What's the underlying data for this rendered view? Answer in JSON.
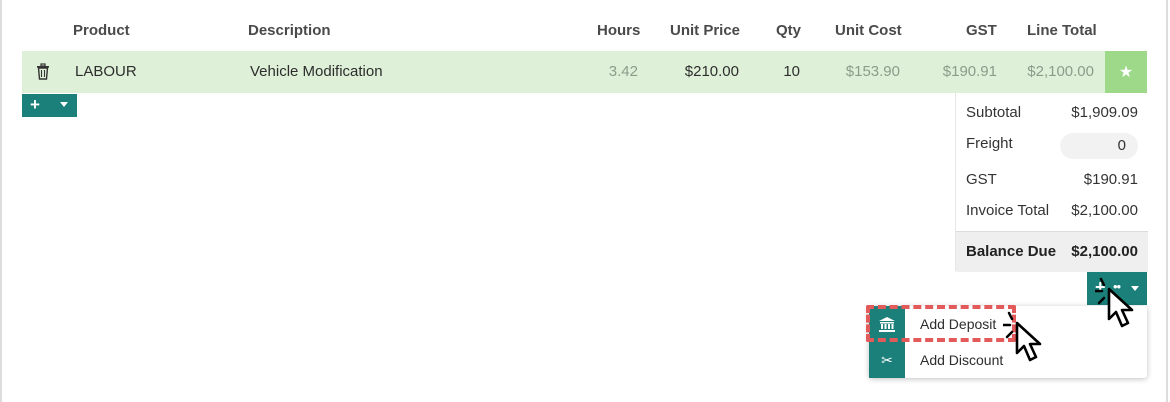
{
  "table": {
    "headers": {
      "product": "Product",
      "description": "Description",
      "hours": "Hours",
      "unit_price": "Unit Price",
      "qty": "Qty",
      "unit_cost": "Unit Cost",
      "gst": "GST",
      "line_total": "Line Total"
    },
    "rows": [
      {
        "product": "LABOUR",
        "description": "Vehicle Modification",
        "hours": "3.42",
        "unit_price": "$210.00",
        "qty": "10",
        "unit_cost": "$153.90",
        "gst": "$190.91",
        "line_total": "$2,100.00"
      }
    ],
    "row_bg": "#dff0d8",
    "row_icon": "trash-icon",
    "row_action_icon": "star-icon"
  },
  "add_line": {
    "icon": "plus-icon",
    "caret_icon": "chevron-down-icon"
  },
  "totals": {
    "subtotal_label": "Subtotal",
    "subtotal_value": "$1,909.09",
    "freight_label": "Freight",
    "freight_value": "0",
    "gst_label": "GST",
    "gst_value": "$190.91",
    "invoice_total_label": "Invoice Total",
    "invoice_total_value": "$2,100.00",
    "balance_due_label": "Balance Due",
    "balance_due_value": "$2,100.00"
  },
  "actions_menu": {
    "items": [
      {
        "label": "Add Deposit",
        "icon": "bank-icon"
      },
      {
        "label": "Add Discount",
        "icon": "scissors-icon"
      }
    ]
  },
  "colors": {
    "accent": "#1b7f7a",
    "row_highlight": "#dff0d8",
    "star_button": "#9ed98a",
    "callout": "#e25a5a"
  }
}
